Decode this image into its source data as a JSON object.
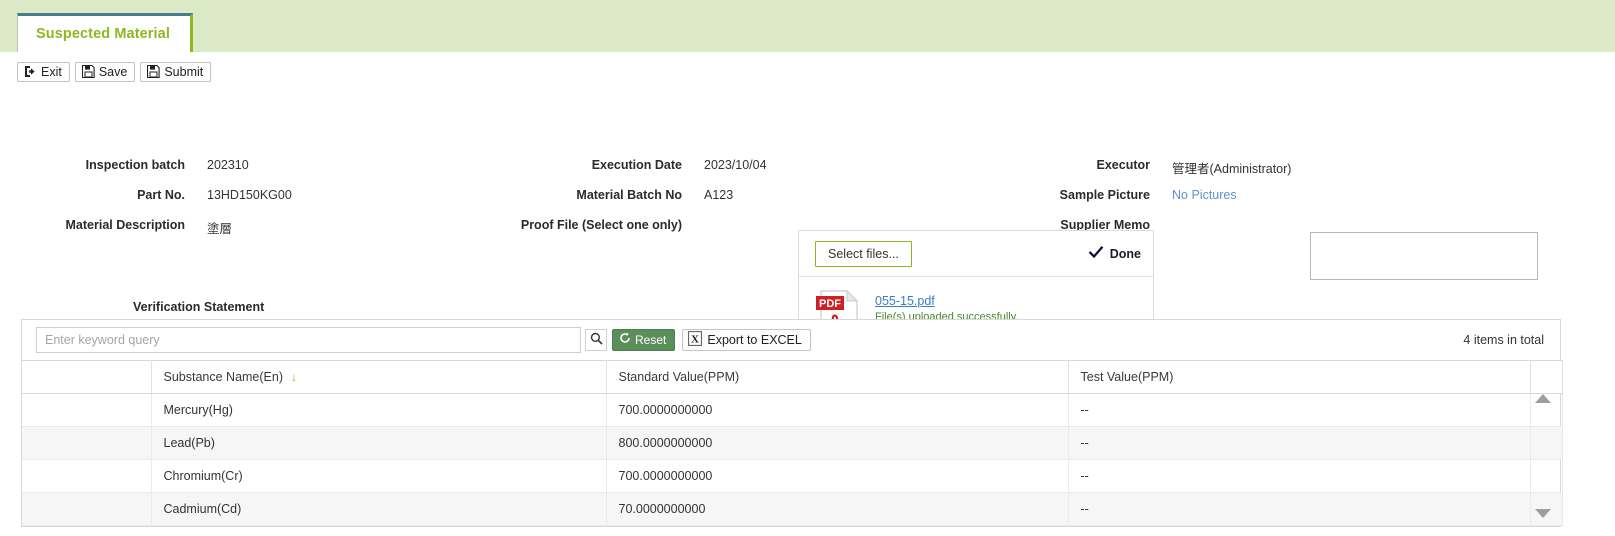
{
  "tab": {
    "label": "Suspected Material"
  },
  "toolbar": {
    "exit_label": "Exit",
    "save_label": "Save",
    "submit_label": "Submit"
  },
  "form": {
    "col1": [
      {
        "label": "Inspection batch",
        "value": "202310"
      },
      {
        "label": "Part No.",
        "value": "13HD150KG00"
      },
      {
        "label": "Material Description",
        "value": "塗層"
      }
    ],
    "col2": [
      {
        "label": "Execution Date",
        "value": "2023/10/04"
      },
      {
        "label": "Material Batch No",
        "value": "A123"
      },
      {
        "label": "Proof File (Select one only)",
        "value": ""
      }
    ],
    "col3": [
      {
        "label": "Executor",
        "value": "管理者(Administrator)"
      },
      {
        "label": "Sample Picture",
        "value": "No Pictures"
      },
      {
        "label": "Supplier Memo",
        "value": ""
      }
    ]
  },
  "upload": {
    "select_files_label": "Select files...",
    "done_label": "Done",
    "file_name": "055-15.pdf",
    "file_status": "File(s) uploaded successfully.",
    "pdf_badge": "PDF",
    "pdf_brand": "Adobe",
    "remove_label": "✕",
    "accent_color": "#3f7d16",
    "border_color": "#8cb820"
  },
  "memo": {
    "value": "",
    "placeholder": ""
  },
  "verification": {
    "title": "Verification Statement",
    "search_placeholder": "Enter keyword query",
    "search_value": "",
    "reset_label": "Reset",
    "export_label": "Export to EXCEL",
    "excel_glyph": "X",
    "total_label": "4 items in total",
    "columns": [
      "",
      "Substance Name(En)",
      "Standard Value(PPM)",
      "Test Value(PPM)",
      ""
    ],
    "sort_indicator": "↓",
    "rows": [
      {
        "select": "",
        "name": "Mercury(Hg)",
        "standard": "700.0000000000",
        "test": "--"
      },
      {
        "select": "",
        "name": "Lead(Pb)",
        "standard": "800.0000000000",
        "test": "--"
      },
      {
        "select": "",
        "name": "Chromium(Cr)",
        "standard": "700.0000000000",
        "test": "--"
      },
      {
        "select": "",
        "name": "Cadmium(Cd)",
        "standard": "70.0000000000",
        "test": "--"
      }
    ]
  },
  "colors": {
    "tab_green": "#8cb820",
    "header_bg": "#dce9c6",
    "link_blue": "#3a7fc4",
    "reset_green": "#5a8f5a"
  }
}
